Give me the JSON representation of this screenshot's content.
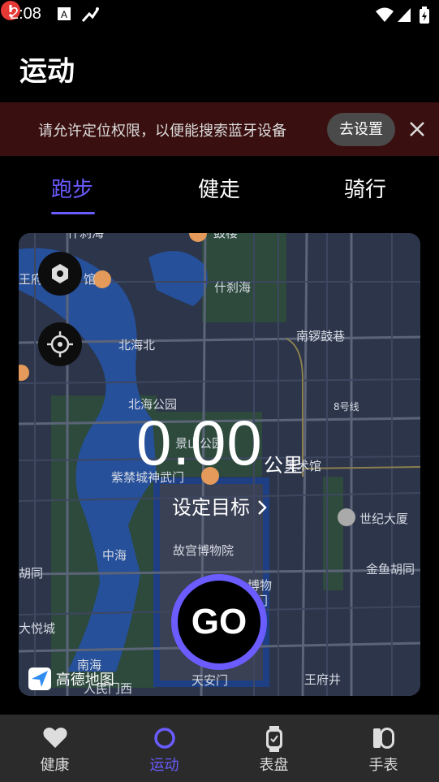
{
  "status_bar": {
    "time": "2:08"
  },
  "header": {
    "title": "运动"
  },
  "banner": {
    "message": "请允许定位权限，以便能搜索蓝牙设备",
    "action_label": "去设置"
  },
  "tabs": [
    {
      "label": "跑步",
      "active": true
    },
    {
      "label": "健走",
      "active": false
    },
    {
      "label": "骑行",
      "active": false
    }
  ],
  "map": {
    "labels": [
      "什刹海",
      "南锣鼓巷",
      "北海北",
      "北海公园",
      "景山公园",
      "紫禁城神武门",
      "美术馆",
      "8号线",
      "世纪大厦",
      "故宫博物院",
      "中海",
      "金鱼胡同",
      "博物",
      "门",
      "南海",
      "天安门",
      "王府井",
      "大悦城",
      "胡同",
      "王府",
      "馆",
      "鼓楼",
      "什刹海",
      "人民门西"
    ],
    "provider": "高德地图"
  },
  "workout": {
    "distance": "0.00",
    "unit": "公里",
    "goal_label": "设定目标",
    "go_label": "GO"
  },
  "bottom_nav": [
    {
      "label": "健康",
      "active": false
    },
    {
      "label": "运动",
      "active": true
    },
    {
      "label": "表盘",
      "active": false
    },
    {
      "label": "手表",
      "active": false
    }
  ],
  "colors": {
    "accent": "#6a5cff",
    "banner_bg": "#3a0f0f",
    "nav_bg": "#2b2b2b"
  }
}
